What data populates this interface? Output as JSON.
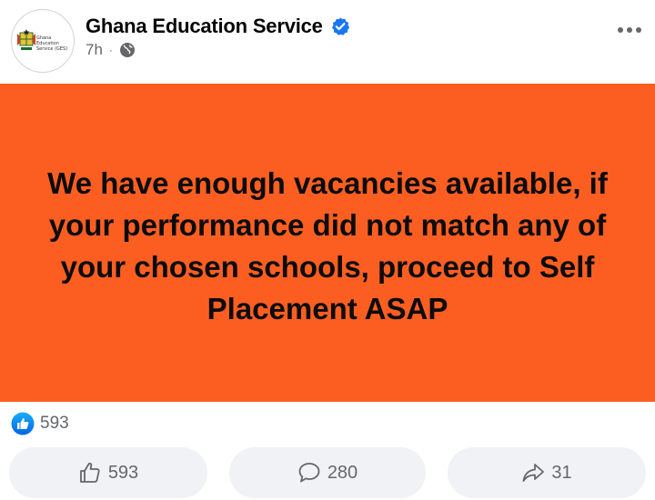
{
  "post": {
    "page_name": "Ghana Education Service",
    "logo_text": "Ghana Education Service (GES)",
    "time": "7h",
    "separator": "·",
    "message": "We have enough vacancies available, if your performance did not match any of your chosen schools, proceed to Self Placement ASAP",
    "banner_color": "#fc5e22",
    "verified_color": "#1877f2"
  },
  "reactions": {
    "count": "593",
    "icon": "like-reaction-icon"
  },
  "actions": {
    "like_count": "593",
    "comment_count": "280",
    "share_count": "31"
  }
}
